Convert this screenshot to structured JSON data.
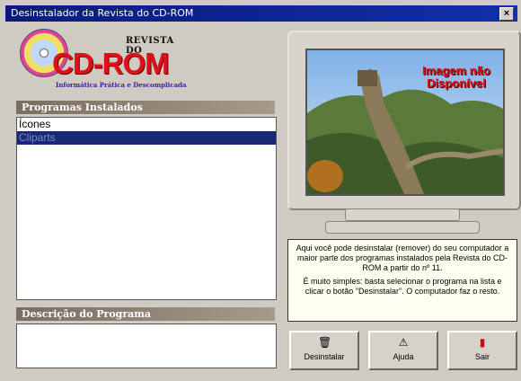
{
  "window": {
    "title": "Desinstalador da Revista do CD-ROM",
    "close_label": "×"
  },
  "logo": {
    "revista": "REVISTA DO",
    "brand": "CD-ROM",
    "tagline": "Informática Prática e Descomplicada"
  },
  "programs": {
    "header": "Programas Instalados",
    "items": [
      "Ícones",
      "Cliparts"
    ],
    "selected_index": 1
  },
  "description": {
    "header": "Descrição do Programa",
    "text": ""
  },
  "preview": {
    "overlay": "Imagem não Disponível"
  },
  "info": {
    "para1": "Aqui você pode desinstalar (remover) do seu computador a maior parte dos programas instalados pela Revista do CD-ROM a partir do nº 11.",
    "para2": "É muito simples: basta selecionar o programa na lista e clicar o botão \"Desinstalar\". O computador faz o resto."
  },
  "buttons": {
    "uninstall": {
      "label": "Desinstalar",
      "icon": "trash-icon"
    },
    "help": {
      "label": "Ajuda",
      "icon": "help-icon"
    },
    "exit": {
      "label": "Sair",
      "icon": "exit-door-icon"
    }
  },
  "colors": {
    "titlebar": "#0a1a7a",
    "selection": "#1a2878",
    "brand_red": "#e0101a"
  }
}
